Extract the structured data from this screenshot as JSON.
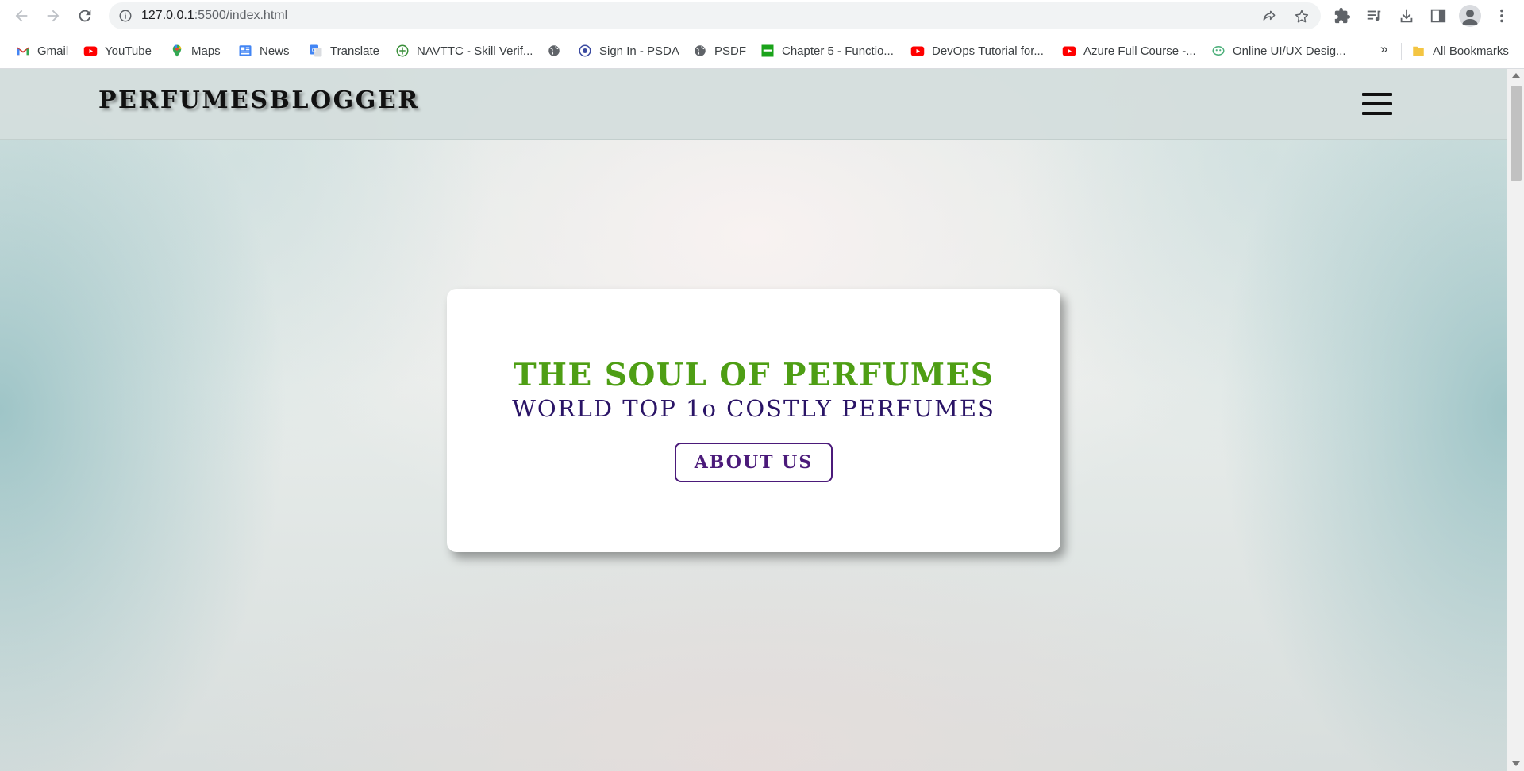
{
  "browser": {
    "url_host": "127.0.0.1",
    "url_rest": ":5500/index.html",
    "icons": {
      "back": "back-arrow-icon",
      "forward": "forward-arrow-icon",
      "reload": "reload-icon",
      "site_info": "info-icon",
      "share": "share-icon",
      "bookmark": "star-icon",
      "extensions": "puzzle-icon",
      "media": "media-queue-icon",
      "downloads": "download-icon",
      "side_panel": "side-panel-icon",
      "profile": "avatar-icon",
      "menu": "kebab-menu-icon"
    }
  },
  "bookmarks": {
    "items": [
      {
        "label": "Gmail",
        "icon": "gmail-icon"
      },
      {
        "label": "YouTube",
        "icon": "youtube-icon"
      },
      {
        "label": "Maps",
        "icon": "maps-icon"
      },
      {
        "label": "News",
        "icon": "news-icon"
      },
      {
        "label": "Translate",
        "icon": "translate-icon"
      },
      {
        "label": "NAVTTC - Skill Verif...",
        "icon": "navttc-icon"
      },
      {
        "label": "",
        "icon": "globe-icon"
      },
      {
        "label": "Sign In - PSDA",
        "icon": "psda-icon"
      },
      {
        "label": "PSDF",
        "icon": "globe-icon"
      },
      {
        "label": "Chapter 5 - Functio...",
        "icon": "chapter-icon"
      },
      {
        "label": "DevOps Tutorial for...",
        "icon": "youtube-icon"
      },
      {
        "label": "Azure Full Course -...",
        "icon": "youtube-icon"
      },
      {
        "label": "Online UI/UX Desig...",
        "icon": "uiux-icon"
      }
    ],
    "overflow": "»",
    "all_bookmarks": "All Bookmarks",
    "all_bookmarks_icon": "folder-icon"
  },
  "site": {
    "logo": "PERFUMESBLOGGER",
    "menu_icon": "hamburger-menu-icon",
    "hero": {
      "title": "THE SOUL OF PERFUMES",
      "subtitle": "WORLD TOP 1o COSTLY PERFUMES",
      "button": "ABOUT US"
    }
  },
  "colors": {
    "hero_title": "#4e9e14",
    "hero_subtitle": "#2a1466",
    "button": "#4b1a7a",
    "header_bg": "#d4dedd"
  }
}
